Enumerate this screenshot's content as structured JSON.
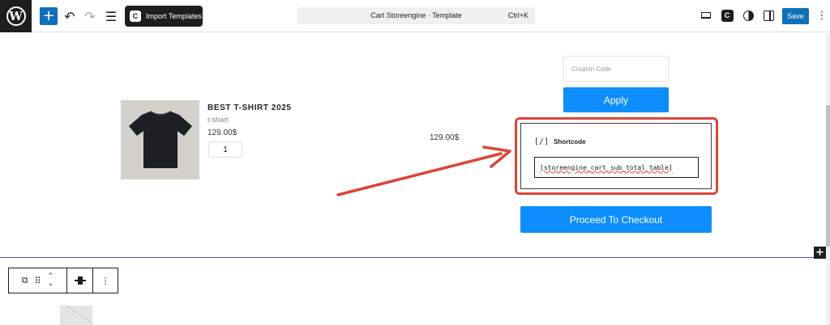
{
  "topbar": {
    "import_label": "Import Templates",
    "doc_title": "Cart Storeengine · Template",
    "shortcut": "Ctrl+K",
    "save_label": "Save"
  },
  "cart": {
    "product_name": "BEST T-SHIRT 2025",
    "product_variant": "t-shart",
    "product_price": "129.00$",
    "quantity": "1",
    "line_total": "129.00$"
  },
  "sidebar": {
    "coupon_placeholder": "Coupon Code",
    "apply_label": "Apply",
    "checkout_label": "Proceed To Checkout"
  },
  "shortcode_block": {
    "label": "Shortcode",
    "icon_glyph": "[/]",
    "value": "[storeengine_cart_sub_total_table]"
  },
  "colors": {
    "accent": "#0d8efc",
    "wp_blue": "#0f6fb8",
    "highlight_red": "#d9463a",
    "dark": "#1e1e1e"
  },
  "icons": [
    "wordpress-icon",
    "plus-icon",
    "undo-icon",
    "redo-icon",
    "list-view-icon",
    "storeengine-icon",
    "laptop-icon",
    "contrast-icon",
    "sidebar-icon",
    "more-vertical-icon",
    "duplicate-icon",
    "drag-icon",
    "move-icon",
    "align-icon"
  ]
}
